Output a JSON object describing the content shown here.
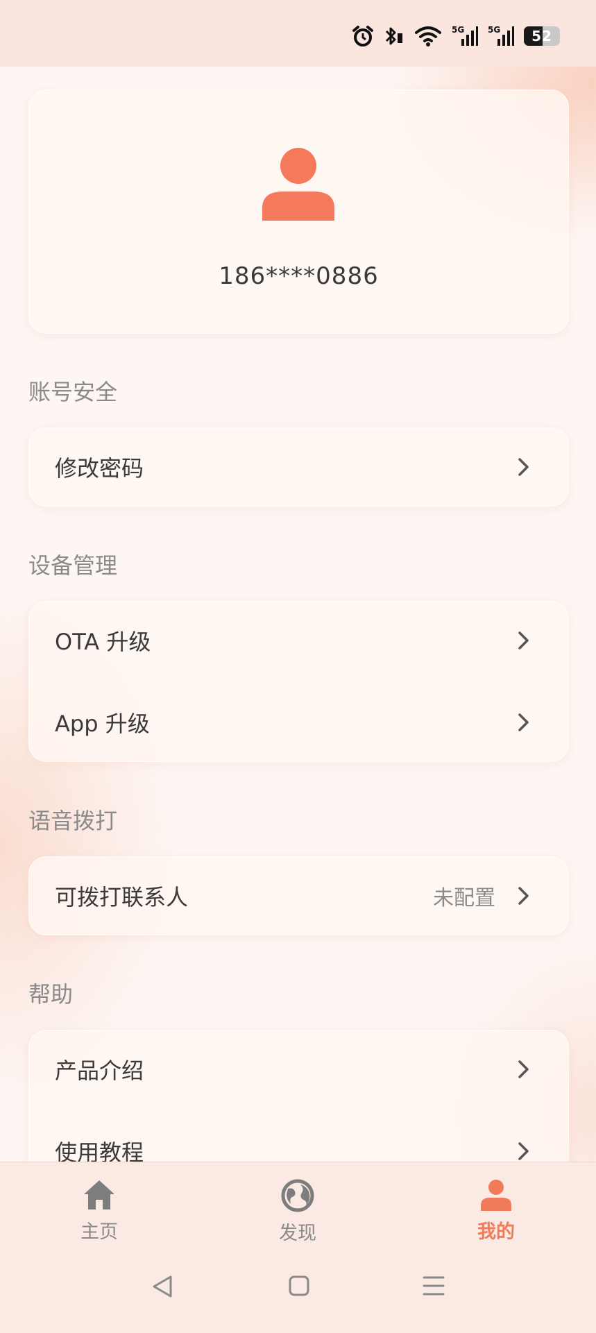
{
  "status_bar": {
    "icons": [
      "alarm-icon",
      "bluetooth-icon",
      "wifi-icon",
      "signal-5g-icon",
      "signal-5g-icon",
      "battery-icon"
    ],
    "signal_label": "5G",
    "battery_level": "52"
  },
  "profile": {
    "avatar_icon": "user-avatar-icon",
    "phone": "186****0886"
  },
  "sections": {
    "account_security": {
      "title": "账号安全",
      "items": [
        {
          "label": "修改密码"
        }
      ]
    },
    "device_management": {
      "title": "设备管理",
      "items": [
        {
          "label": "OTA 升级"
        },
        {
          "label": "App 升级"
        }
      ]
    },
    "voice_call": {
      "title": "语音拨打",
      "items": [
        {
          "label": "可拨打联系人",
          "value": "未配置"
        }
      ]
    },
    "help": {
      "title": "帮助",
      "items": [
        {
          "label": "产品介绍"
        },
        {
          "label": "使用教程"
        }
      ]
    }
  },
  "bottom_nav": {
    "tabs": [
      {
        "label": "主页",
        "icon": "home-icon",
        "active": false
      },
      {
        "label": "发现",
        "icon": "globe-icon",
        "active": false
      },
      {
        "label": "我的",
        "icon": "profile-icon",
        "active": true
      }
    ]
  },
  "system_nav": [
    "back-icon",
    "home-square-icon",
    "menu-icon"
  ],
  "colors": {
    "accent": "#f07b5b",
    "text_primary": "#3a3a3a",
    "text_secondary": "#8a8a8a",
    "inactive_icon": "#7d7d7d"
  }
}
